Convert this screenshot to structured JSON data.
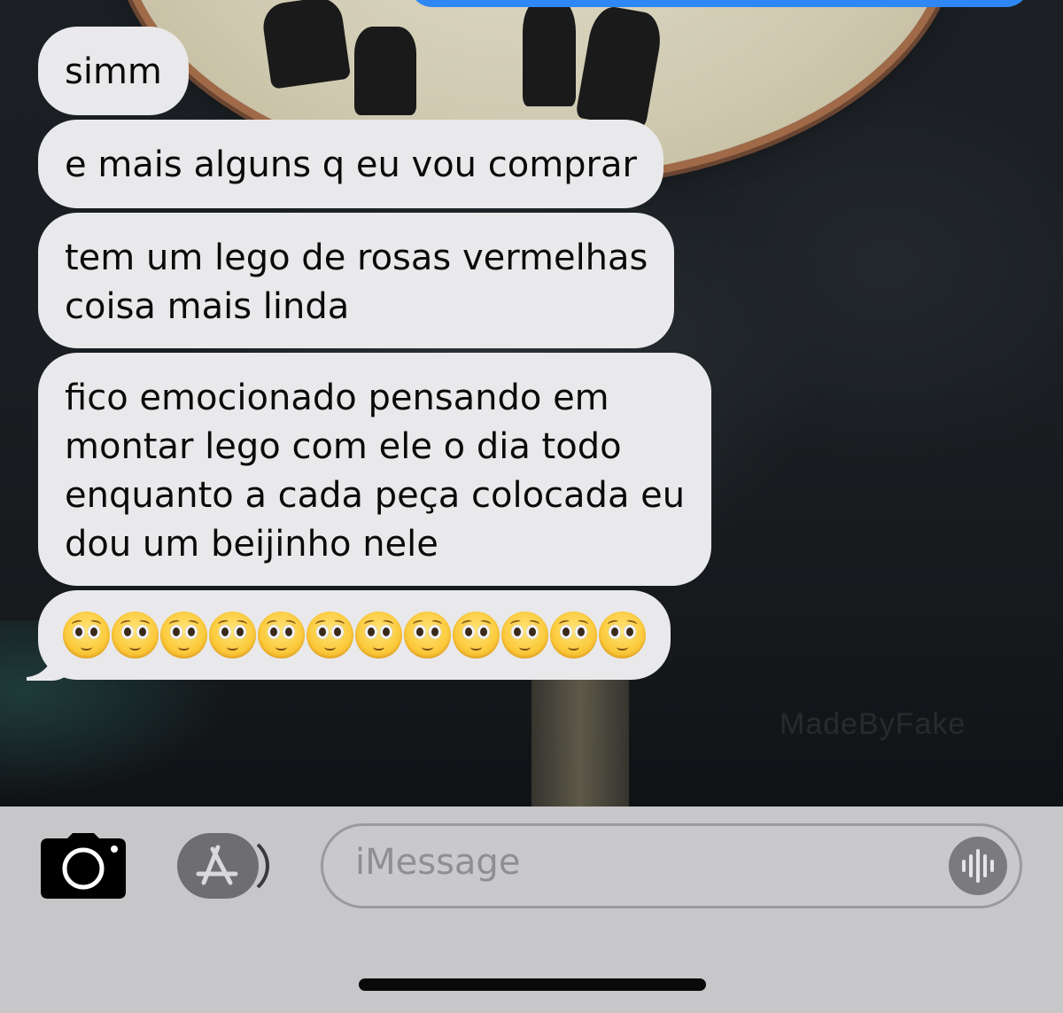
{
  "messages": [
    {
      "lines": [
        "simm"
      ]
    },
    {
      "lines": [
        "e mais alguns q eu vou comprar"
      ]
    },
    {
      "lines": [
        "tem um lego de rosas vermelhas",
        "coisa mais linda"
      ]
    },
    {
      "lines": [
        "fico emocionado pensando em",
        "montar lego com ele o dia todo",
        "enquanto a cada peça colocada eu",
        "dou um beijinho nele"
      ]
    },
    {
      "emoji": "pleading-face",
      "emoji_count": 12
    }
  ],
  "colors": {
    "received_bubble": "#e9e9eb",
    "sent_bubble": "#2f87f5",
    "toolbar": "#c7c7c9"
  },
  "toolbar": {
    "camera_icon": "camera-icon",
    "apps_icon": "app-store-icon",
    "input_placeholder": "iMessage",
    "audio_icon": "audio-waveform-icon"
  }
}
